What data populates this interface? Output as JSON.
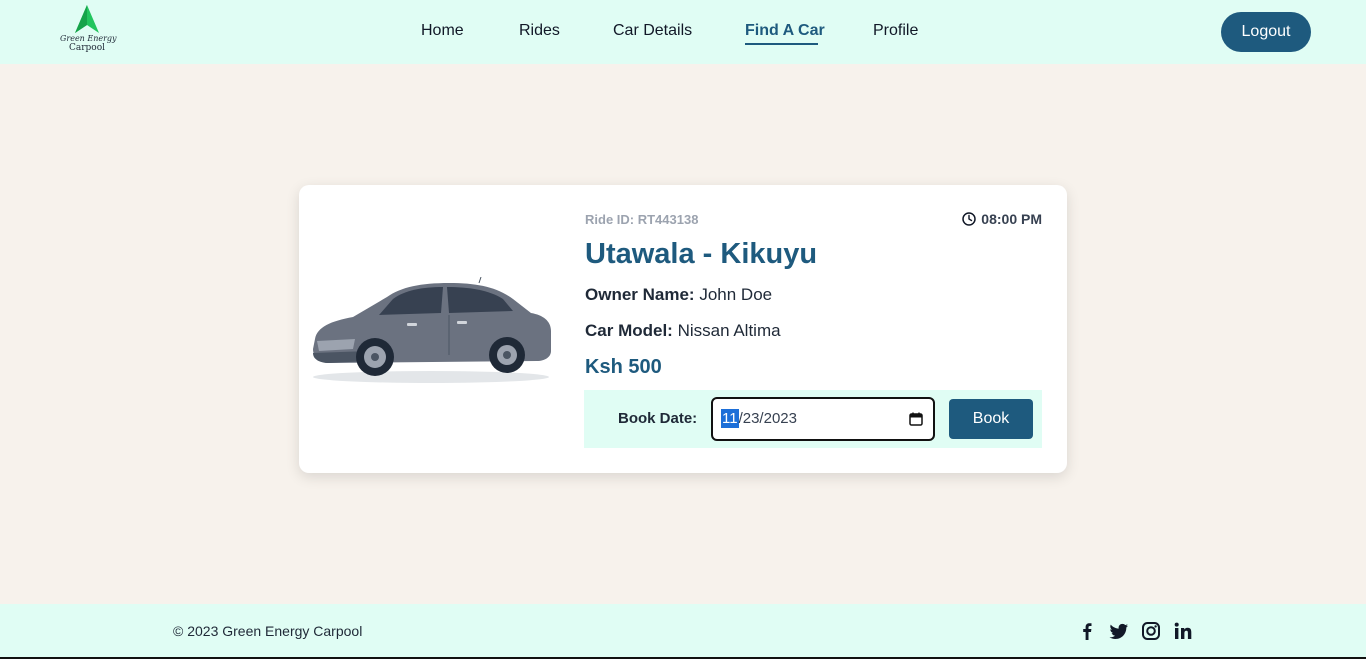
{
  "brand": {
    "line1": "Green Energy",
    "line2": "Carpool",
    "logo_icon": "green-arrow-icon",
    "color": "#22c55e"
  },
  "nav": {
    "links": [
      {
        "label": "Home",
        "active": false
      },
      {
        "label": "Rides",
        "active": false
      },
      {
        "label": "Car Details",
        "active": false
      },
      {
        "label": "Find A Car",
        "active": true
      },
      {
        "label": "Profile",
        "active": false
      }
    ],
    "logout_label": "Logout"
  },
  "ride": {
    "id_text": "Ride ID: RT443138",
    "time": "08:00 PM",
    "route": "Utawala - Kikuyu",
    "owner_label": "Owner Name:",
    "owner_value": "John Doe",
    "model_label": "Car Model:",
    "model_value": "Nissan Altima",
    "price": "Ksh 500"
  },
  "booking": {
    "label": "Book Date:",
    "date_month": "11",
    "date_rest": "/23/2023",
    "button_label": "Book"
  },
  "footer": {
    "copyright": "© 2023 Green Energy Carpool",
    "social_icons": [
      "facebook-icon",
      "twitter-icon",
      "instagram-icon",
      "linkedin-icon"
    ]
  },
  "colors": {
    "accent": "#1e5a7e",
    "nav_bg": "#e0fdf4",
    "page_bg": "#f7f2ec"
  }
}
